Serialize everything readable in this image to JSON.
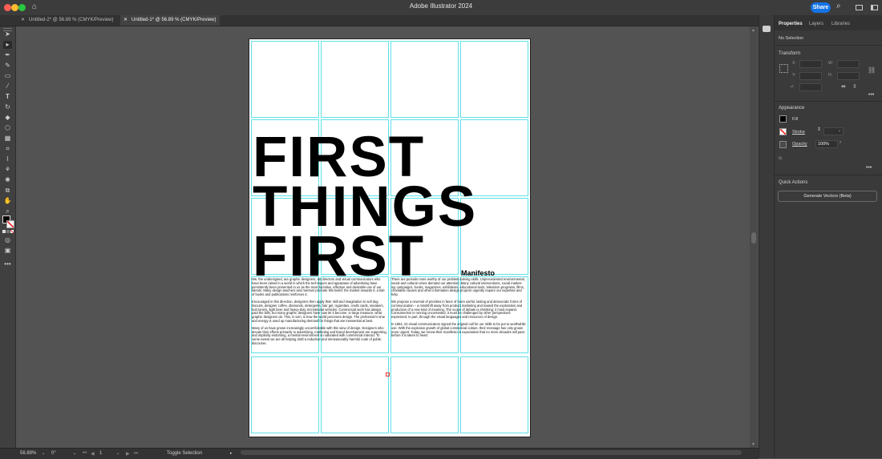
{
  "app": {
    "title": "Adobe Illustrator 2024",
    "share_label": "Share"
  },
  "tabs": [
    {
      "label": "Untitled-2* @ 56.89 % (CMYK/Preview)",
      "active": false
    },
    {
      "label": "Untitled-1* @ 56.89 % (CMYK/Preview)",
      "active": true
    }
  ],
  "artboard": {
    "headline": [
      "FIRST",
      "THINGS",
      "FIRST"
    ],
    "subtitle": "Manifesto",
    "col1": [
      "We, the undersigned, are graphic designers, art directors and visual communicators who have been raised in a world in which the techniques and apparatus of advertising have persistently been presented to us as the most lucrative, effective and desirable use of our talents. Many design teachers and mentors promote this belief; the market rewards it; a tide of books and publications reinforces it.",
      "Encouraged in this direction, designers then apply their skill and imagination to sell dog biscuits, designer coffee, diamonds, detergents, hair gel, cigarettes, credit cards, sneakers, butt toners, light beer and heavy-duty recreational vehicles. Commercial work has always paid the bills, but many graphic designers have now let it become, in large measure, what graphic designers do. This, in turn, is how the world perceives design. The profession's time and energy is used up manufacturing demand for things that are inessential at best.",
      "Many of us have grown increasingly uncomfortable with this view of design. Designers who devote their efforts primarily to advertising, marketing and brand development are supporting, and implicitly endorsing, a mental environment so saturated with commercial interact. To some extent we are all helping draft a reductive and immeasurably harmful code of public discourse."
    ],
    "col2": [
      "There are pursuits more worthy of our problem-solving skills. Unprecedented environmental, social and cultural crises demand our attention. Many cultural interventions, social market- ing campaigns, books, magazines, exhibitions, educational tools, television programs, films, charitable causes and other information design projects urgently require our expertise and help.",
      "We propose a reversal of priorities in favor of more useful, lasting and democratic forms of communication – a mindshift away from product marketing and toward the exploration and production of a new kind of meaning. The scope of debate is shrinking; it must expand. Consumerism is running uncontested; it must be challenged by other perspectives expressed, in part, through the visual languages and resources of design.",
      "In 1964, 22 visual communicators signed the original call for our skills to be put to worthwhile use. With the explosive growth of global commercial culture, their message has only grown more urgent. Today, we renew their manifesto in expectation that no more decades will pass before it is taken to heart."
    ]
  },
  "panel": {
    "tabs": [
      "Properties",
      "Layers",
      "Libraries"
    ],
    "no_selection": "No Selection",
    "transform": {
      "title": "Transform",
      "x_label": "X:",
      "y_label": "Y:",
      "w_label": "W:",
      "h_label": "H:",
      "angle_label": "⊿:"
    },
    "appearance": {
      "title": "Appearance",
      "fill_label": "Fill",
      "stroke_label": "Stroke",
      "opacity_label": "Opacity",
      "opacity_value": "100%",
      "fx_label": "fx."
    },
    "quick_actions": {
      "title": "Quick Actions",
      "generate_label": "Generate Vectors (Beta)"
    }
  },
  "status": {
    "zoom": "56.89%",
    "rotation": "0°",
    "artboard_num": "1",
    "toggle_label": "Toggle Selection"
  },
  "colors": {
    "accent": "#1473e6",
    "guide": "#5ee0e6"
  }
}
